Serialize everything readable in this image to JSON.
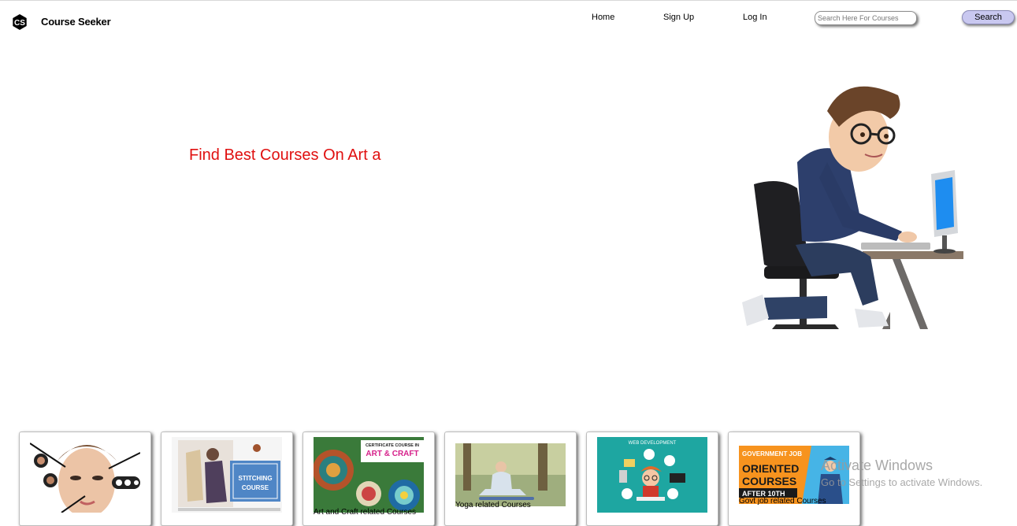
{
  "header": {
    "logo_letters": "CS",
    "brand": "Course Seeker",
    "nav": {
      "home": "Home",
      "signup": "Sign Up",
      "login": "Log In"
    },
    "search": {
      "placeholder": "Search Here For Courses",
      "button_label": "Search"
    }
  },
  "hero": {
    "headline": "Find Best Courses On Art a"
  },
  "cards": [
    {
      "label": ""
    },
    {
      "label": "",
      "image_text": "STITCHING COURSE"
    },
    {
      "label": "Art and Craft related Courses",
      "image_text_top": "CERTIFICATE COURSE IN",
      "image_text_main": "ART & CRAFT"
    },
    {
      "label": "Yoga related Courses"
    },
    {
      "label": "",
      "image_text_top": "WEB DEVELOPMENT"
    },
    {
      "label": "Govt job related Courses",
      "image_text_top": "GOVERNMENT JOB",
      "image_text_main1": "ORIENTED",
      "image_text_main2": "COURSES",
      "image_text_sub": "AFTER 10TH"
    }
  ],
  "watermark": {
    "title": "Activate Windows",
    "subtitle": "Go to Settings to activate Windows."
  },
  "colors": {
    "headline": "#e01010",
    "search_button": "#c9c8f0"
  }
}
